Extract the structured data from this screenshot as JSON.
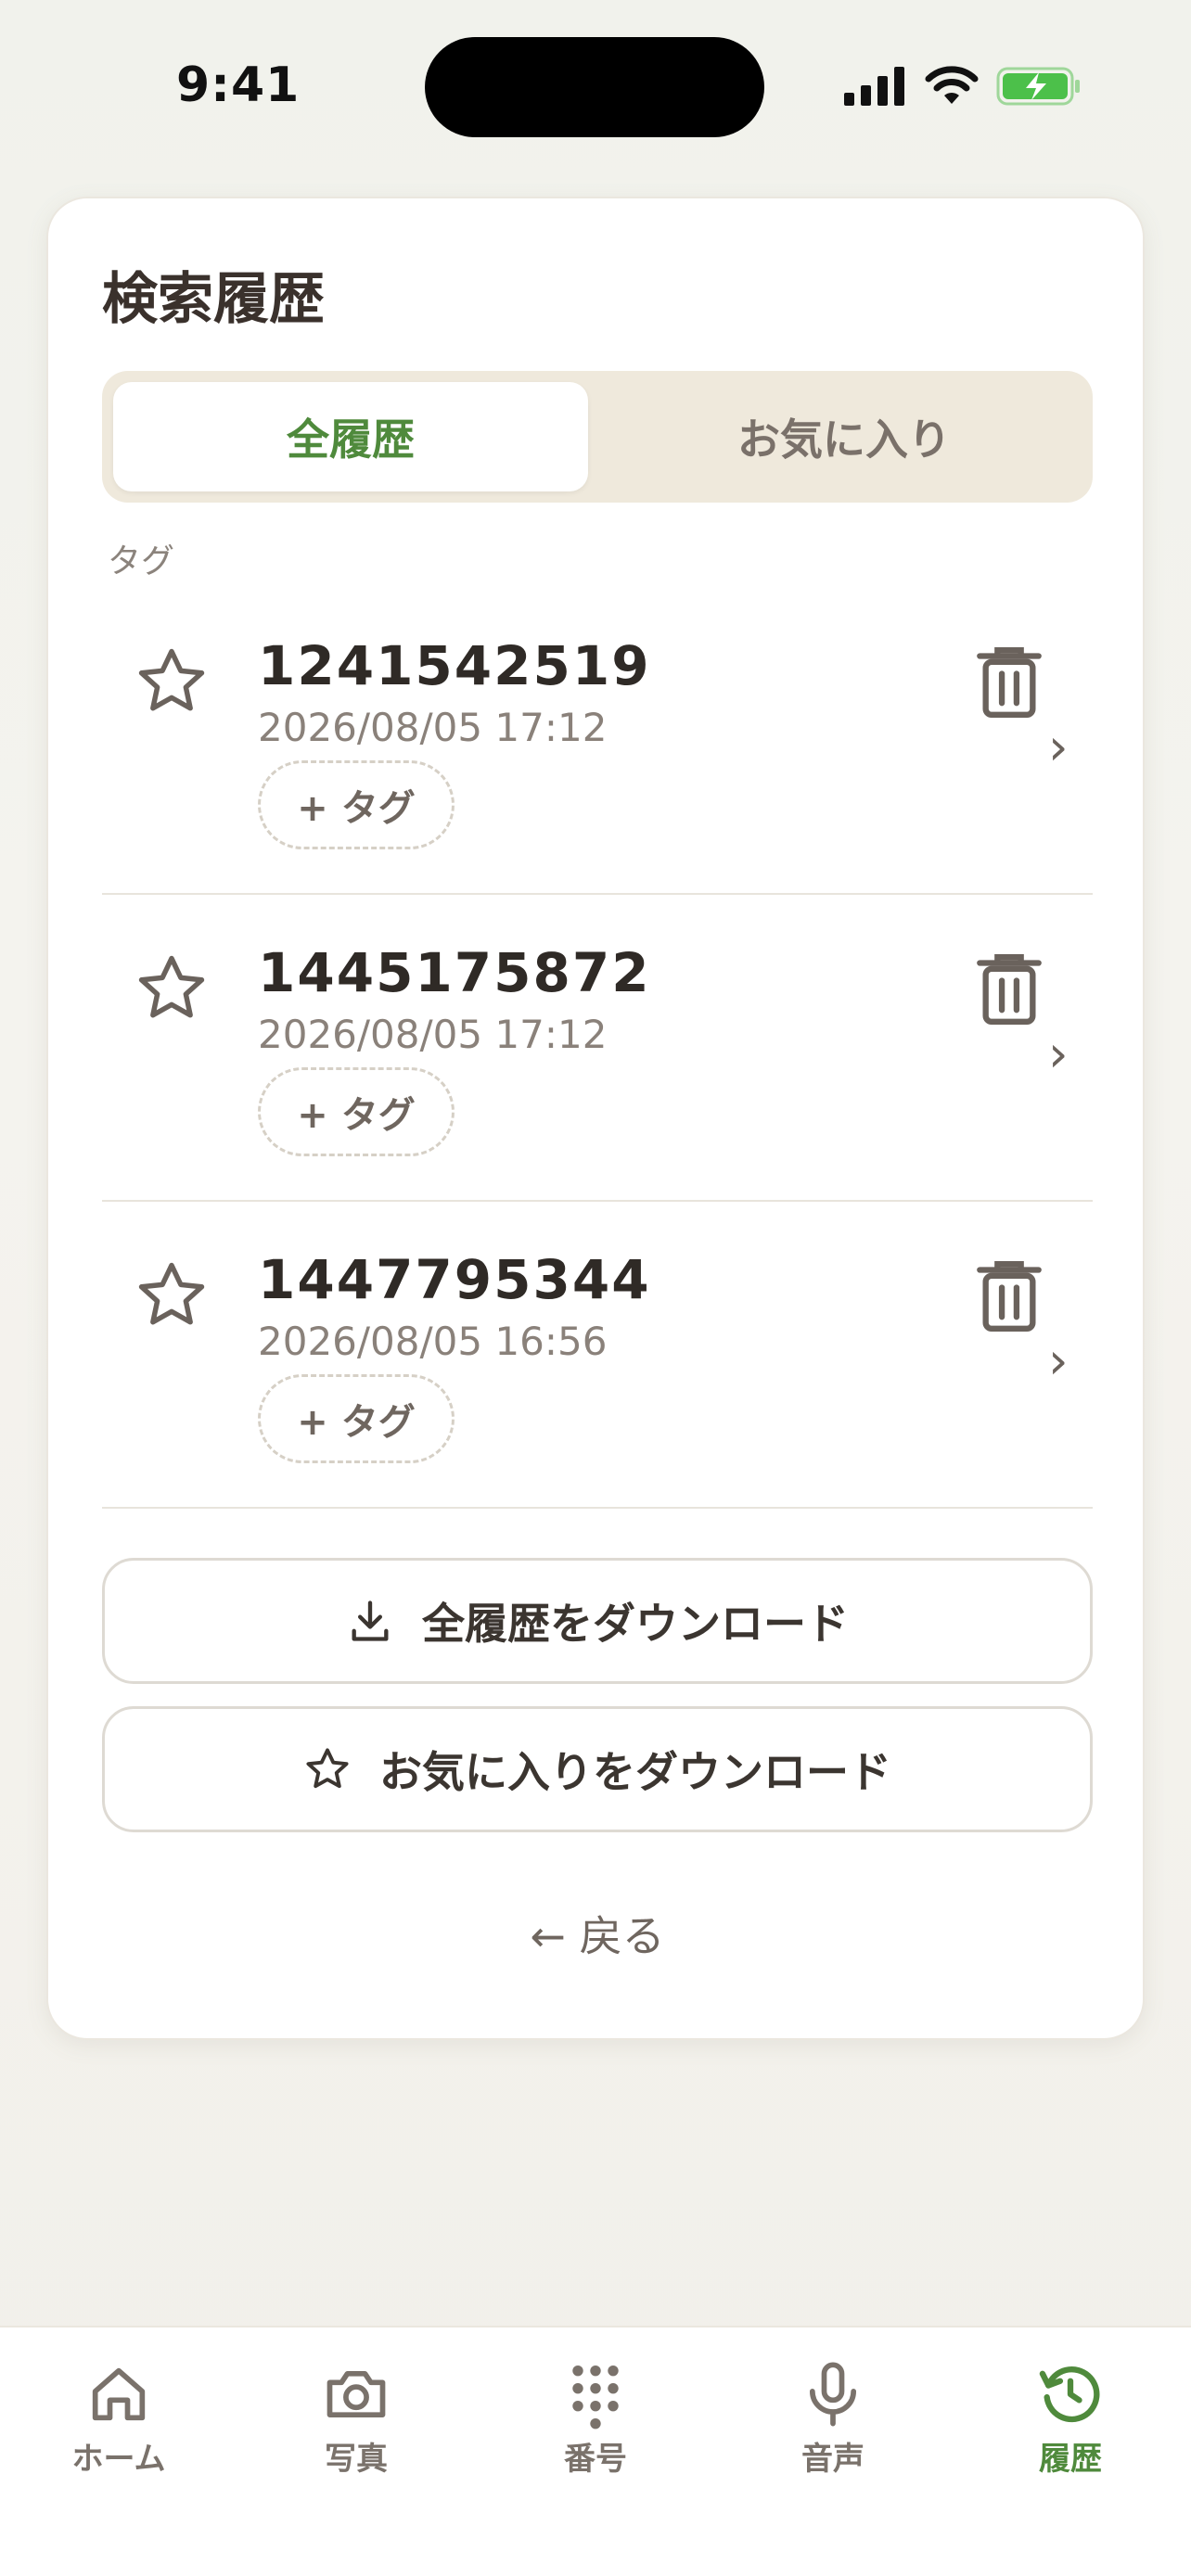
{
  "status": {
    "time": "9:41"
  },
  "header": {
    "title": "検索履歴"
  },
  "segments": {
    "all": "全履歴",
    "favorites": "お気に入り"
  },
  "tag_section_label": "タグ",
  "items": [
    {
      "number": "1241542519",
      "date": "2026/08/05 17:12",
      "tag_button": "+ タグ"
    },
    {
      "number": "1445175872",
      "date": "2026/08/05 17:12",
      "tag_button": "+ タグ"
    },
    {
      "number": "1447795344",
      "date": "2026/08/05 16:56",
      "tag_button": "+ タグ"
    }
  ],
  "actions": {
    "download_all": "全履歴をダウンロード",
    "download_favorites": "お気に入りをダウンロード",
    "back": "← 戻る"
  },
  "tabbar": {
    "home": "ホーム",
    "photo": "写真",
    "number": "番号",
    "voice": "音声",
    "history": "履歴"
  },
  "colors": {
    "accent": "#4f8a3c",
    "battery": "#4cc04a"
  }
}
